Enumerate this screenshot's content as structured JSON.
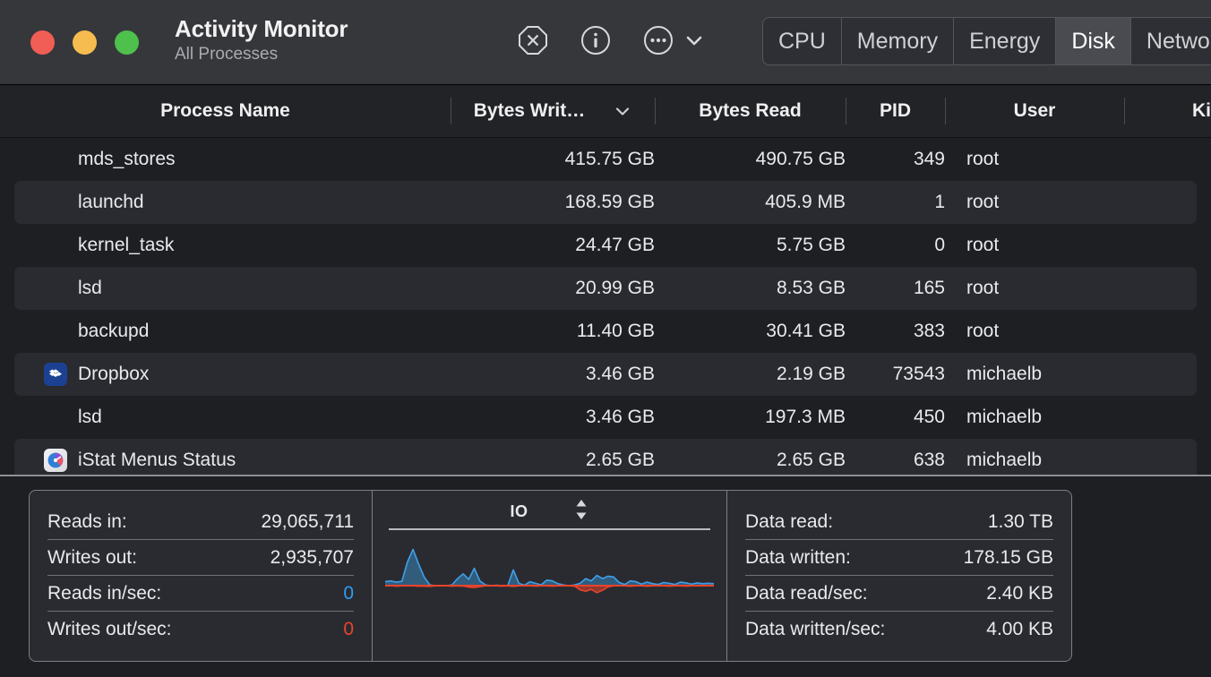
{
  "window": {
    "title": "Activity Monitor",
    "subtitle": "All Processes",
    "traffic_lights": {
      "close": "#f15e56",
      "minimize": "#f6bc4f",
      "maximize": "#4ec04c"
    }
  },
  "toolbar": {
    "stop_icon": "stop-process-octagon-x-icon",
    "info_icon": "inspect-process-info-icon",
    "more_icon": "more-options-ellipsis-icon",
    "chevron_icon": "chevron-down-icon",
    "tabs": [
      {
        "label": "CPU",
        "active": false
      },
      {
        "label": "Memory",
        "active": false
      },
      {
        "label": "Energy",
        "active": false
      },
      {
        "label": "Disk",
        "active": true
      },
      {
        "label": "Network",
        "active": false
      }
    ]
  },
  "table": {
    "columns": [
      {
        "key": "process_name",
        "label": "Process Name",
        "sorted": false
      },
      {
        "key": "bytes_written",
        "label": "Bytes Writ…",
        "sorted": true,
        "sort_icon": "chevron-down-icon"
      },
      {
        "key": "bytes_read",
        "label": "Bytes Read",
        "sorted": false
      },
      {
        "key": "pid",
        "label": "PID",
        "sorted": false
      },
      {
        "key": "user",
        "label": "User",
        "sorted": false
      },
      {
        "key": "kind",
        "label": "Ki",
        "sorted": false
      }
    ],
    "rows": [
      {
        "icon": null,
        "process_name": "mds_stores",
        "bytes_written": "415.75 GB",
        "bytes_read": "490.75 GB",
        "pid": "349",
        "user": "root"
      },
      {
        "icon": null,
        "process_name": "launchd",
        "bytes_written": "168.59 GB",
        "bytes_read": "405.9 MB",
        "pid": "1",
        "user": "root"
      },
      {
        "icon": null,
        "process_name": "kernel_task",
        "bytes_written": "24.47 GB",
        "bytes_read": "5.75 GB",
        "pid": "0",
        "user": "root"
      },
      {
        "icon": null,
        "process_name": "lsd",
        "bytes_written": "20.99 GB",
        "bytes_read": "8.53 GB",
        "pid": "165",
        "user": "root"
      },
      {
        "icon": null,
        "process_name": "backupd",
        "bytes_written": "11.40 GB",
        "bytes_read": "30.41 GB",
        "pid": "383",
        "user": "root"
      },
      {
        "icon": "dropbox-app-icon",
        "process_name": "Dropbox",
        "bytes_written": "3.46 GB",
        "bytes_read": "2.19 GB",
        "pid": "73543",
        "user": "michaelb"
      },
      {
        "icon": null,
        "process_name": "lsd",
        "bytes_written": "3.46 GB",
        "bytes_read": "197.3 MB",
        "pid": "450",
        "user": "michaelb"
      },
      {
        "icon": "istat-menus-app-icon",
        "process_name": "iStat Menus Status",
        "bytes_written": "2.65 GB",
        "bytes_read": "2.65 GB",
        "pid": "638",
        "user": "michaelb"
      }
    ]
  },
  "footer": {
    "left_stats": [
      {
        "label": "Reads in:",
        "value": "29,065,711",
        "color": "default"
      },
      {
        "label": "Writes out:",
        "value": "2,935,707",
        "color": "default"
      },
      {
        "label": "Reads in/sec:",
        "value": "0",
        "color": "blue"
      },
      {
        "label": "Writes out/sec:",
        "value": "0",
        "color": "red"
      }
    ],
    "right_stats": [
      {
        "label": "Data read:",
        "value": "1.30 TB",
        "color": "default"
      },
      {
        "label": "Data written:",
        "value": "178.15 GB",
        "color": "default"
      },
      {
        "label": "Data read/sec:",
        "value": "2.40 KB",
        "color": "default"
      },
      {
        "label": "Data written/sec:",
        "value": "4.00 KB",
        "color": "default"
      }
    ],
    "graph": {
      "title": "IO",
      "stepper_icon": "up-down-stepper-icon",
      "read_color": "#3ea0e8",
      "write_color": "#e8432b"
    }
  },
  "chart_data": {
    "type": "area",
    "title": "IO",
    "xlabel": "",
    "ylabel": "",
    "series": [
      {
        "name": "Reads (IO in)",
        "color": "#3ea0e8",
        "direction": "up",
        "values": [
          0.1,
          0.12,
          0.09,
          0.11,
          0.6,
          0.92,
          0.55,
          0.22,
          0.02,
          0.0,
          0.0,
          0.0,
          0.02,
          0.18,
          0.3,
          0.16,
          0.44,
          0.12,
          0.02,
          0.0,
          0.01,
          0.0,
          0.0,
          0.4,
          0.06,
          0.01,
          0.1,
          0.06,
          0.02,
          0.14,
          0.12,
          0.05,
          0.02,
          0.0,
          0.02,
          0.06,
          0.18,
          0.12,
          0.26,
          0.18,
          0.24,
          0.22,
          0.08,
          0.03,
          0.12,
          0.1,
          0.04,
          0.09,
          0.05,
          0.03,
          0.08,
          0.06,
          0.03,
          0.09,
          0.07,
          0.04,
          0.07,
          0.05,
          0.06,
          0.05
        ]
      },
      {
        "name": "Writes (IO out)",
        "color": "#e8432b",
        "direction": "down",
        "values": [
          0.0,
          0.0,
          0.02,
          0.01,
          0.01,
          0.01,
          0.02,
          0.02,
          0.03,
          0.01,
          0.0,
          0.01,
          0.02,
          0.01,
          0.02,
          0.06,
          0.08,
          0.04,
          0.01,
          0.0,
          0.01,
          0.02,
          0.01,
          0.03,
          0.01,
          0.0,
          0.01,
          0.02,
          0.01,
          0.01,
          0.02,
          0.01,
          0.0,
          0.01,
          0.02,
          0.18,
          0.24,
          0.16,
          0.3,
          0.2,
          0.05,
          0.01,
          0.0,
          0.01,
          0.02,
          0.01,
          0.01,
          0.02,
          0.01,
          0.0,
          0.01,
          0.02,
          0.01,
          0.01,
          0.02,
          0.01,
          0.01,
          0.01,
          0.01,
          0.01
        ]
      }
    ],
    "baseline": 0,
    "grid": false,
    "legend": "none"
  }
}
